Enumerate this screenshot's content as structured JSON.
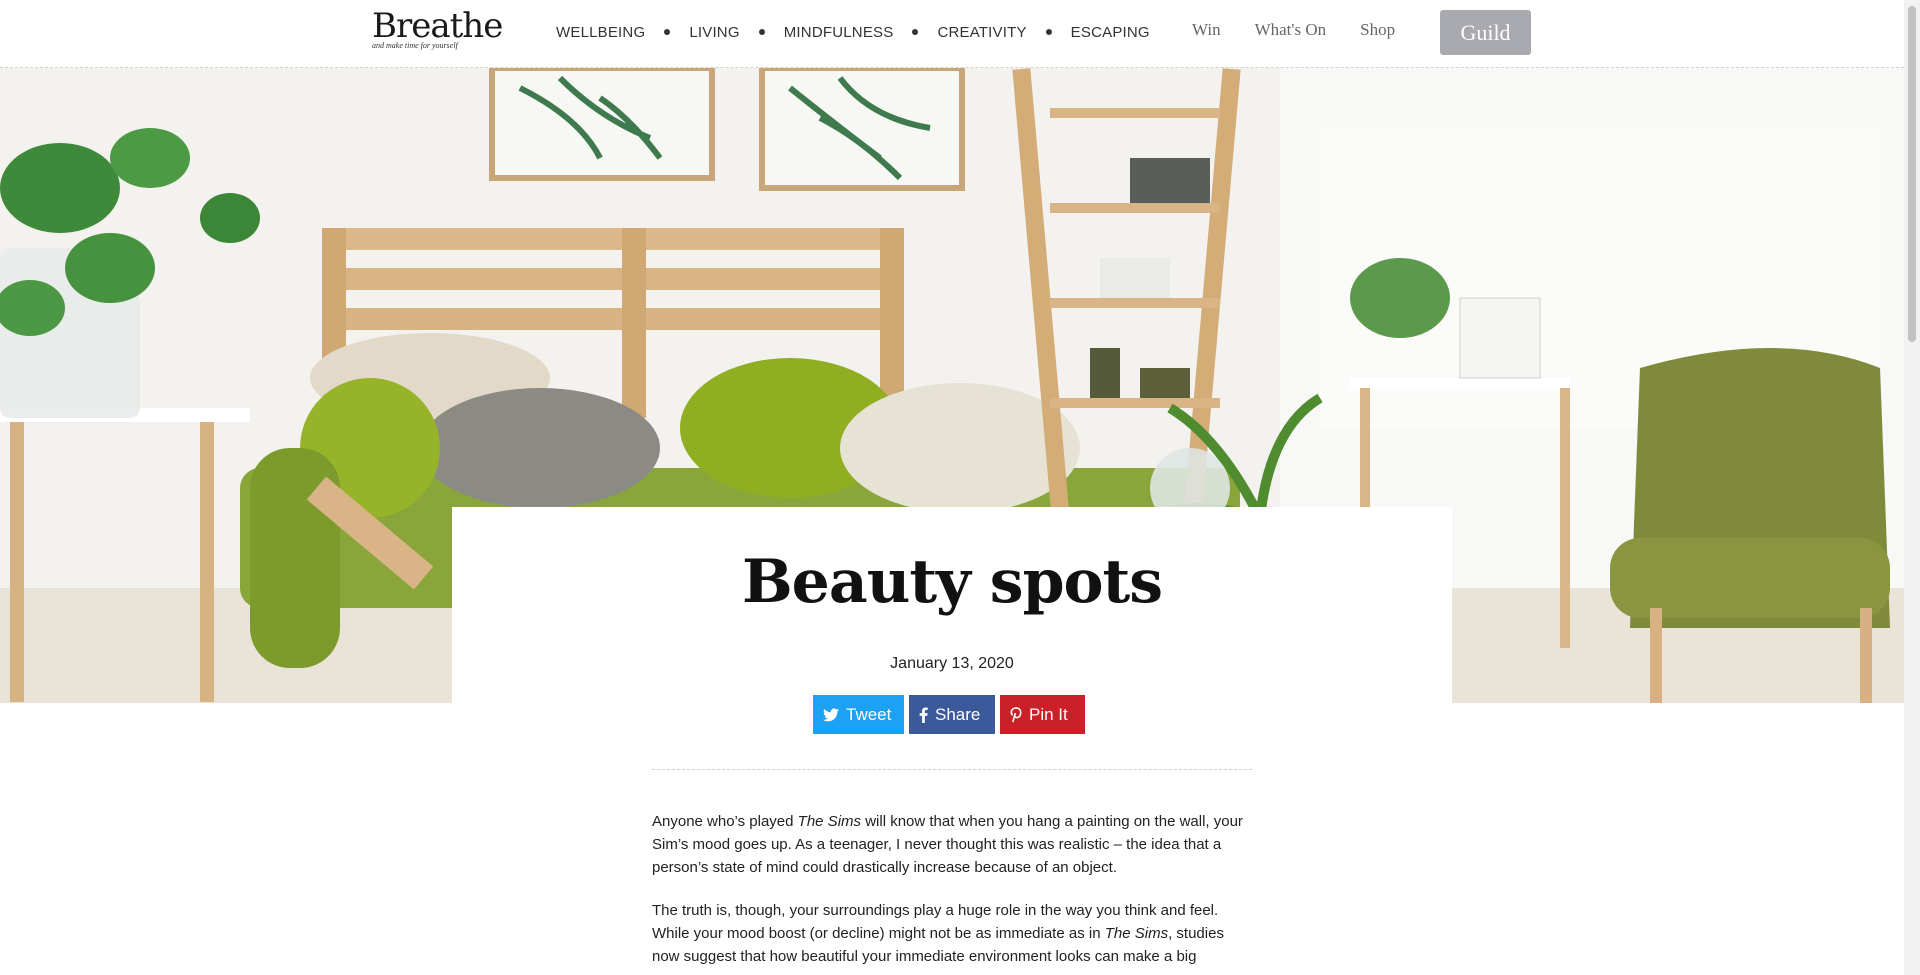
{
  "header": {
    "logo": {
      "word": "Breathe",
      "tagline": "and make time for yourself"
    },
    "nav_main": [
      "WELLBEING",
      "LIVING",
      "MINDFULNESS",
      "CREATIVITY",
      "ESCAPING"
    ],
    "nav_secondary": [
      "Win",
      "What's On",
      "Shop"
    ],
    "guild_label": "Guild"
  },
  "hero": {
    "image": "living-room-interior-photo"
  },
  "article": {
    "title": "Beauty spots",
    "date": "January 13, 2020",
    "share": {
      "tweet": "Tweet",
      "share": "Share",
      "pin": "Pin It"
    },
    "p1": {
      "a": "Anyone who’s played ",
      "em": "The Sims",
      "b": " will know that when you hang a painting on the wall, your Sim’s mood goes up. As a teenager, I never thought this was realistic – the idea that a person’s state of mind could drastically increase because of an object."
    },
    "p2": {
      "a": "The truth is, though, your surroundings play a huge role in the way you think and feel. While your mood boost (or decline) might not be as immediate as in ",
      "em": "The Sims",
      "b": ", studies now suggest that how beautiful your immediate environment looks can make a big"
    }
  },
  "colors": {
    "twitter": "#1da1f2",
    "facebook": "#3b5998",
    "pinterest": "#cb2027",
    "guild": "#a9a9b0"
  }
}
